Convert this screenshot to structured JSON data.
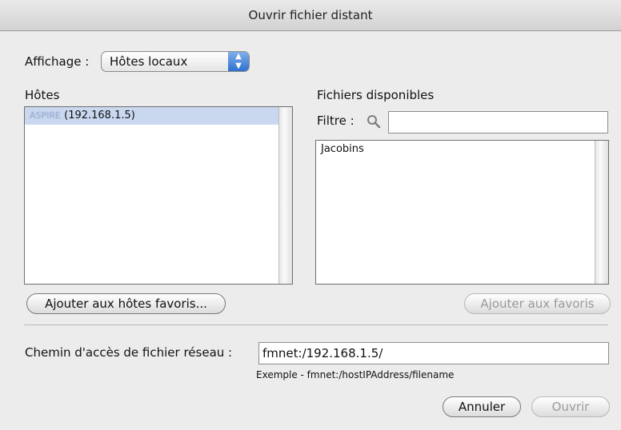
{
  "window": {
    "title": "Ouvrir fichier distant"
  },
  "display": {
    "label": "Affichage :",
    "selected": "Hôtes locaux"
  },
  "hosts": {
    "label": "Hôtes",
    "items": [
      {
        "name": "ASPIRE",
        "address": "(192.168.1.5)"
      }
    ],
    "add_button": "Ajouter aux hôtes favoris..."
  },
  "files": {
    "label": "Fichiers disponibles",
    "filter_label": "Filtre :",
    "filter_value": "",
    "items": [
      "Jacobins"
    ],
    "add_button": "Ajouter aux favoris"
  },
  "path": {
    "label": "Chemin d'accès de fichier réseau :",
    "value": "fmnet:/192.168.1.5/",
    "example": "Exemple - fmnet:/hostIPAddress/filename"
  },
  "buttons": {
    "cancel": "Annuler",
    "open": "Ouvrir"
  }
}
